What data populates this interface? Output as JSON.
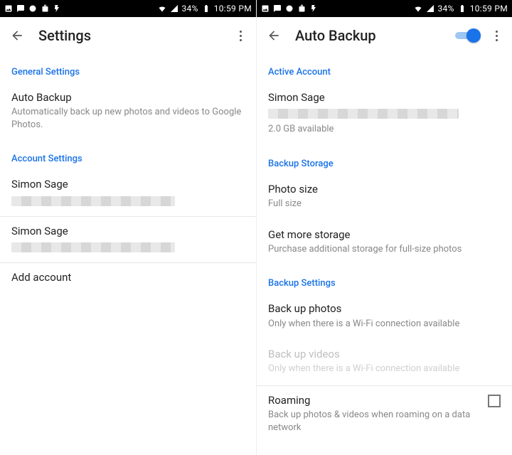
{
  "status": {
    "battery": "34%",
    "time": "10:59 PM"
  },
  "left": {
    "title": "Settings",
    "sections": {
      "general": {
        "header": "General Settings",
        "auto_backup_title": "Auto Backup",
        "auto_backup_sub": "Automatically back up new photos and videos to Google Photos."
      },
      "account": {
        "header": "Account Settings",
        "acc1_name": "Simon Sage",
        "acc2_name": "Simon Sage",
        "add_account": "Add account"
      }
    }
  },
  "right": {
    "title": "Auto Backup",
    "toggle_on": true,
    "sections": {
      "active": {
        "header": "Active Account",
        "name": "Simon Sage",
        "storage": "2.0 GB available"
      },
      "backup_storage": {
        "header": "Backup Storage",
        "photo_size_title": "Photo size",
        "photo_size_value": "Full size",
        "get_more_title": "Get more storage",
        "get_more_sub": "Purchase additional storage for full-size photos"
      },
      "backup_settings": {
        "header": "Backup Settings",
        "photos_title": "Back up photos",
        "photos_sub": "Only when there is a Wi-Fi connection available",
        "videos_title": "Back up videos",
        "videos_sub": "Only when there is a Wi-Fi connection available",
        "roaming_title": "Roaming",
        "roaming_sub": "Back up photos & videos when roaming on a data network"
      }
    }
  }
}
